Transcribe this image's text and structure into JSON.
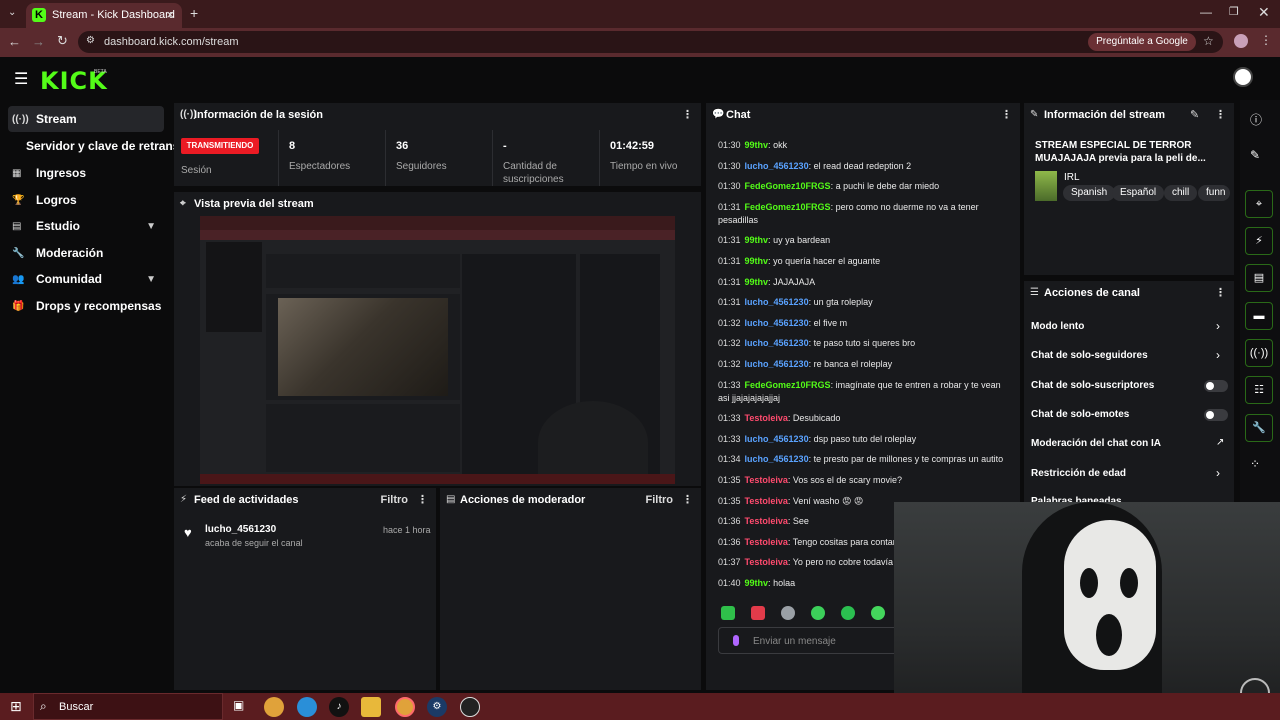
{
  "browser": {
    "tab_title": "Stream - Kick Dashboard",
    "url": "dashboard.kick.com/stream",
    "ask_google": "Pregúntale a Google"
  },
  "brand": {
    "logo": "KICK",
    "beta": "BETA"
  },
  "sidebar": {
    "items": [
      {
        "label": "Stream",
        "icon": "broadcast-icon"
      },
      {
        "label": "Servidor y clave de retransm"
      },
      {
        "label": "Ingresos",
        "icon": "chart-icon"
      },
      {
        "label": "Logros",
        "icon": "trophy-icon"
      },
      {
        "label": "Estudio",
        "icon": "studio-icon"
      },
      {
        "label": "Moderación",
        "icon": "wrench-icon"
      },
      {
        "label": "Comunidad",
        "icon": "community-icon"
      },
      {
        "label": "Drops y recompensas",
        "icon": "gift-icon"
      }
    ]
  },
  "session": {
    "title": "Información de la sesión",
    "badge": "TRANSMITIENDO",
    "session_label": "Sesión",
    "stats": [
      {
        "value": "8",
        "label": "Espectadores"
      },
      {
        "value": "36",
        "label": "Seguidores"
      },
      {
        "value": "-",
        "label": "Cantidad de suscripciones"
      },
      {
        "value": "01:42:59",
        "label": "Tiempo en vivo"
      }
    ]
  },
  "preview": {
    "title": "Vista previa del stream"
  },
  "feed": {
    "title": "Feed de actividades",
    "filter": "Filtro",
    "item": {
      "user": "lucho_4561230",
      "text": "acaba de seguir el canal",
      "time": "hace 1 hora"
    }
  },
  "modactions": {
    "title": "Acciones de moderador",
    "filter": "Filtro"
  },
  "chat": {
    "title": "Chat",
    "messages": [
      {
        "time": "01:30",
        "user": "99thv",
        "color": "green",
        "text": "okk"
      },
      {
        "time": "01:30",
        "user": "lucho_4561230",
        "color": "blue",
        "text": "el read dead redeption 2"
      },
      {
        "time": "01:30",
        "user": "FedeGomez10FRGS",
        "color": "green",
        "text": "a puchi le debe dar miedo"
      },
      {
        "time": "01:31",
        "user": "FedeGomez10FRGS",
        "color": "green",
        "text": "pero como no duerme no va a tener",
        "text2": "pesadillas"
      },
      {
        "time": "01:31",
        "user": "99thv",
        "color": "green",
        "text": "uy ya bardean"
      },
      {
        "time": "01:31",
        "user": "99thv",
        "color": "green",
        "text": "yo quería hacer el aguante"
      },
      {
        "time": "01:31",
        "user": "99thv",
        "color": "green",
        "text": "JAJAJAJA"
      },
      {
        "time": "01:31",
        "user": "lucho_4561230",
        "color": "blue",
        "text": "un gta roleplay"
      },
      {
        "time": "01:32",
        "user": "lucho_4561230",
        "color": "blue",
        "text": "el five m"
      },
      {
        "time": "01:32",
        "user": "lucho_4561230",
        "color": "blue",
        "text": "te paso tuto si queres bro"
      },
      {
        "time": "01:32",
        "user": "lucho_4561230",
        "color": "blue",
        "text": "re banca el roleplay"
      },
      {
        "time": "01:33",
        "user": "FedeGomez10FRGS",
        "color": "green",
        "text": "imagínate que te entren a robar y te vean",
        "text2": "asi jjajajajajajjaj"
      },
      {
        "time": "01:33",
        "user": "Testoleiva",
        "color": "pink",
        "text": "Desubicado"
      },
      {
        "time": "01:33",
        "user": "lucho_4561230",
        "color": "blue",
        "text": "dsp paso tuto del roleplay"
      },
      {
        "time": "01:34",
        "user": "lucho_4561230",
        "color": "blue",
        "text": "te presto par de millones y te compras un autito"
      },
      {
        "time": "01:35",
        "user": "Testoleiva",
        "color": "pink",
        "text": "Vos sos el de scary movie?"
      },
      {
        "time": "01:35",
        "user": "Testoleiva",
        "color": "pink",
        "text": "Vení washo 😡 😡"
      },
      {
        "time": "01:36",
        "user": "Testoleiva",
        "color": "pink",
        "text": "See"
      },
      {
        "time": "01:36",
        "user": "Testoleiva",
        "color": "pink",
        "text": "Tengo cositas para contarte"
      },
      {
        "time": "01:37",
        "user": "Testoleiva",
        "color": "pink",
        "text": "Yo pero no cobre todavía"
      },
      {
        "time": "01:40",
        "user": "99thv",
        "color": "green",
        "text": "holaa"
      }
    ],
    "input_placeholder": "Enviar un mensaje"
  },
  "stream_info": {
    "title": "Información del stream",
    "stream_title": "STREAM ESPECIAL DE TERROR MUAJAJAJA previa para la peli de...",
    "category": "IRL",
    "tags": [
      "Spanish",
      "Español",
      "chill",
      "funn"
    ]
  },
  "channel_actions": {
    "title": "Acciones de canal",
    "items": [
      {
        "label": "Modo lento",
        "kind": "chevron"
      },
      {
        "label": "Chat de solo-seguidores",
        "kind": "chevron"
      },
      {
        "label": "Chat de solo-suscriptores",
        "kind": "toggle",
        "on": false
      },
      {
        "label": "Chat de solo-emotes",
        "kind": "toggle",
        "on": false
      },
      {
        "label": "Moderación del chat con IA",
        "kind": "external"
      },
      {
        "label": "Restricción de edad",
        "kind": "chevron"
      },
      {
        "label": "Palabras baneadas",
        "kind": "chevron"
      }
    ]
  },
  "taskbar": {
    "search": "Buscar"
  },
  "colors": {
    "kick_green": "#53fc18",
    "live_red": "#eb1b24",
    "panel": "#18191c"
  }
}
